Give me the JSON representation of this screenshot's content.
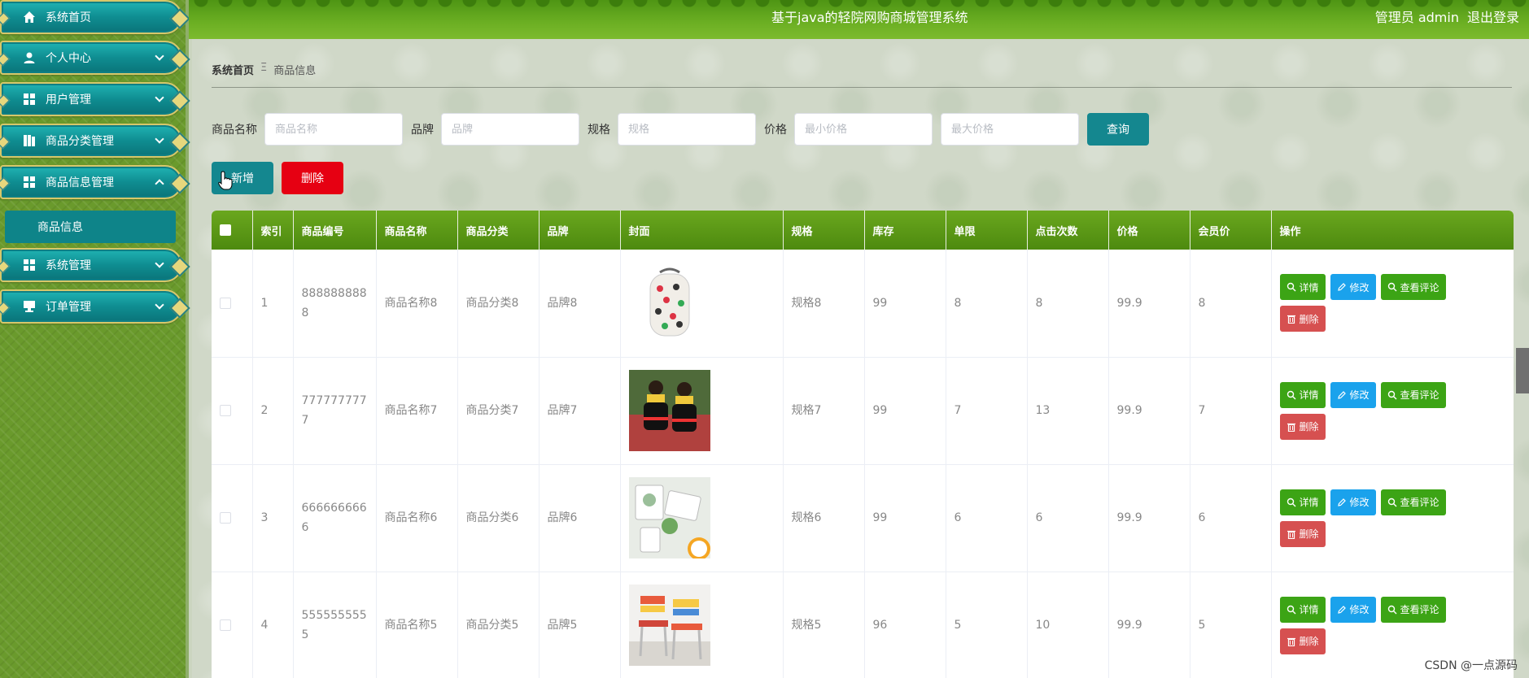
{
  "header": {
    "title": "基于java的轻院网购商城管理系统",
    "user_label": "管理员 admin",
    "logout_label": "退出登录"
  },
  "sidebar": {
    "items": [
      {
        "label": "系统首页",
        "icon": "home-icon"
      },
      {
        "label": "个人中心",
        "icon": "user-icon"
      },
      {
        "label": "用户管理",
        "icon": "grid-icon"
      },
      {
        "label": "商品分类管理",
        "icon": "book-icon"
      },
      {
        "label": "商品信息管理",
        "icon": "grid-icon"
      },
      {
        "label": "系统管理",
        "icon": "grid-icon"
      },
      {
        "label": "订单管理",
        "icon": "monitor-icon"
      }
    ],
    "submenu_label": "商品信息"
  },
  "breadcrumb": {
    "home": "系统首页",
    "separator": "Ξ",
    "current": "商品信息"
  },
  "search": {
    "name_label": "商品名称",
    "name_placeholder": "商品名称",
    "brand_label": "品牌",
    "brand_placeholder": "品牌",
    "spec_label": "规格",
    "spec_placeholder": "规格",
    "price_label": "价格",
    "min_price_placeholder": "最小价格",
    "max_price_placeholder": "最大价格",
    "query_label": "查询"
  },
  "actions": {
    "add_label": "新增",
    "delete_label": "删除"
  },
  "table": {
    "columns": [
      "索引",
      "商品编号",
      "商品名称",
      "商品分类",
      "品牌",
      "封面",
      "规格",
      "库存",
      "单限",
      "点击次数",
      "价格",
      "会员价",
      "操作"
    ],
    "rows": [
      {
        "index": "1",
        "code": "8888888888",
        "name": "商品名称8",
        "category": "商品分类8",
        "brand": "品牌8",
        "spec": "规格8",
        "stock": "99",
        "limit": "8",
        "clicks": "8",
        "price": "99.9",
        "member_price": "8"
      },
      {
        "index": "2",
        "code": "7777777777",
        "name": "商品名称7",
        "category": "商品分类7",
        "brand": "品牌7",
        "spec": "规格7",
        "stock": "99",
        "limit": "7",
        "clicks": "13",
        "price": "99.9",
        "member_price": "7"
      },
      {
        "index": "3",
        "code": "6666666666",
        "name": "商品名称6",
        "category": "商品分类6",
        "brand": "品牌6",
        "spec": "规格6",
        "stock": "99",
        "limit": "6",
        "clicks": "6",
        "price": "99.9",
        "member_price": "6"
      },
      {
        "index": "4",
        "code": "5555555555",
        "name": "商品名称5",
        "category": "商品分类5",
        "brand": "品牌5",
        "spec": "规格5",
        "stock": "96",
        "limit": "5",
        "clicks": "10",
        "price": "99.9",
        "member_price": "5"
      }
    ],
    "op_labels": {
      "detail": "详情",
      "edit": "修改",
      "review": "查看评论",
      "delete": "删除"
    }
  },
  "watermark": "CSDN @一点源码",
  "colors": {
    "teal": "#14878f",
    "header_green": "#5c9a18",
    "danger": "#e60012",
    "op_green": "#3ca415",
    "op_blue": "#1aa2ec",
    "op_red": "#d65050"
  }
}
